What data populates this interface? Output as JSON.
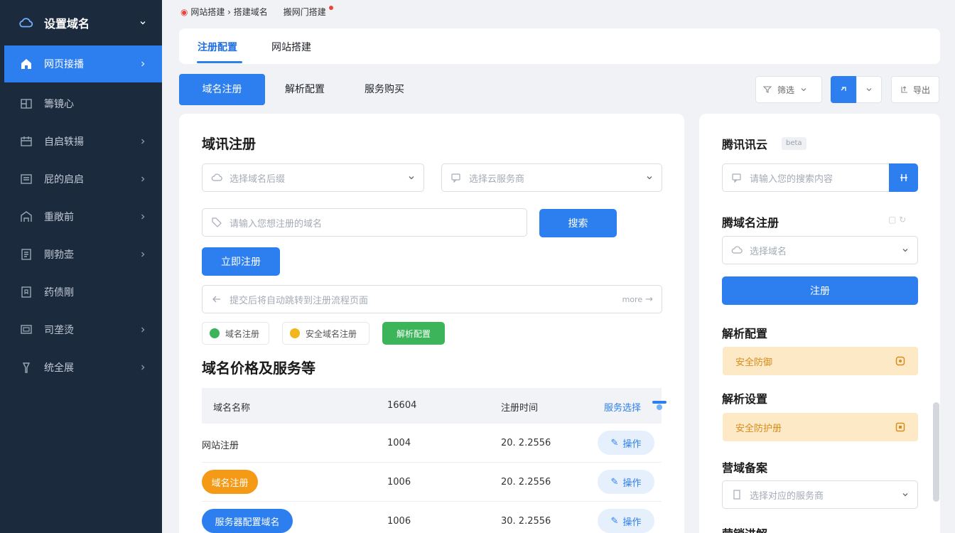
{
  "sidebar": {
    "title": "设置域名",
    "items": [
      {
        "label": "网页接播"
      },
      {
        "label": "籌镜心"
      },
      {
        "label": "自启轶揚"
      },
      {
        "label": "屁的启启"
      },
      {
        "label": "重敞前"
      },
      {
        "label": "剛勃壶"
      },
      {
        "label": "药债剛"
      },
      {
        "label": "司垄烫"
      },
      {
        "label": "统全展"
      }
    ]
  },
  "breadcrumb": {
    "a": "网站搭建 › 搭建域名",
    "b": "搬网门搭建"
  },
  "tabs": [
    {
      "label": "注册配置"
    },
    {
      "label": "网站搭建"
    }
  ],
  "subtabs": [
    {
      "label": "域名注册"
    },
    {
      "label": "解析配置"
    },
    {
      "label": "服务购买"
    }
  ],
  "toolbar": {
    "filter_label": "筛选",
    "export_label": "导出"
  },
  "main": {
    "title": "域讯注册",
    "select1": "选择域名后缀",
    "select2": "选择云服务商",
    "input_placeholder": "请输入您想注册的域名",
    "search_btn": "搜索",
    "add_btn": "立即注册",
    "notice": "提交后将自动跳转到注册流程页面",
    "notice_tag": "more",
    "chips": [
      {
        "label": "域名注册"
      },
      {
        "label": "安全域名注册"
      },
      {
        "label": "解析配置"
      }
    ],
    "section_title": "域名价格及服务等",
    "table": {
      "headers": [
        "域名名称",
        "16604",
        "注册时间",
        "服务选择"
      ],
      "rows": [
        {
          "name": "网站注册",
          "num": "1004",
          "date": "20. 2.2556",
          "action": "操作"
        },
        {
          "name": "域名注册",
          "num": "1006",
          "date": "20. 2.2556",
          "action": "操作"
        },
        {
          "name": "服务器配置域名",
          "num": "1006",
          "date": "30. 2.2556",
          "action": "操作"
        }
      ]
    }
  },
  "right": {
    "brand_title": "腾讯讯云",
    "brand_badge": "beta",
    "search_placeholder": "请输入您的搜索内容",
    "reg_title": "腾域名注册",
    "reg_select": "选择域名",
    "reg_btn": "注册",
    "config_title": "解析配置",
    "warn1": "安全防御",
    "setup_title": "解析设置",
    "warn2": "安全防护册",
    "domain_title": "营域备案",
    "domain_select": "选择对应的服务商",
    "more_title": "营销进解"
  },
  "colors": {
    "primary": "#2d7ff0",
    "sidebar": "#1c2a3e",
    "warning_bg": "#fde9c6",
    "success": "#3cb55a",
    "orange": "#f59a16"
  }
}
